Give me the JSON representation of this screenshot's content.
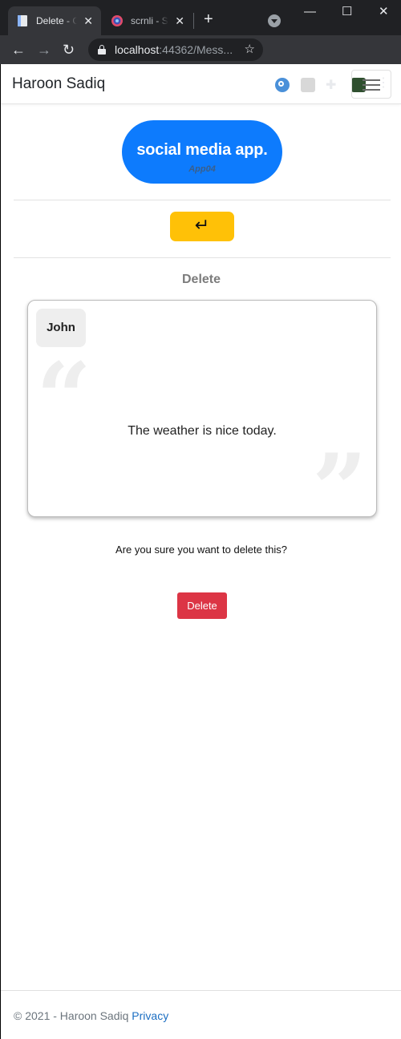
{
  "browser": {
    "tabs": [
      {
        "title": "Delete - C",
        "active": true
      },
      {
        "title": "scrnli - Sc",
        "active": false
      }
    ],
    "new_tab_symbol": "+",
    "address": {
      "host": "localhost",
      "rest": ":44362/Mess..."
    },
    "window_controls": [
      "minimize",
      "maximize",
      "close"
    ]
  },
  "navbar": {
    "brand": "Haroon Sadiq"
  },
  "logo": {
    "title": "social media app.",
    "subtitle": "App04",
    "color": "#0d7bfd"
  },
  "back_button": {
    "symbol": "↵",
    "color": "#ffc107"
  },
  "heading": "Delete",
  "card": {
    "author": "John",
    "message": "The weather is nice today.",
    "quote_open": "“",
    "quote_close": "”"
  },
  "confirm_text": "Are you sure you want to delete this?",
  "delete_button": {
    "label": "Delete",
    "color": "#dc3545"
  },
  "footer": {
    "text": "© 2021 - Haroon Sadiq",
    "link": "Privacy"
  }
}
